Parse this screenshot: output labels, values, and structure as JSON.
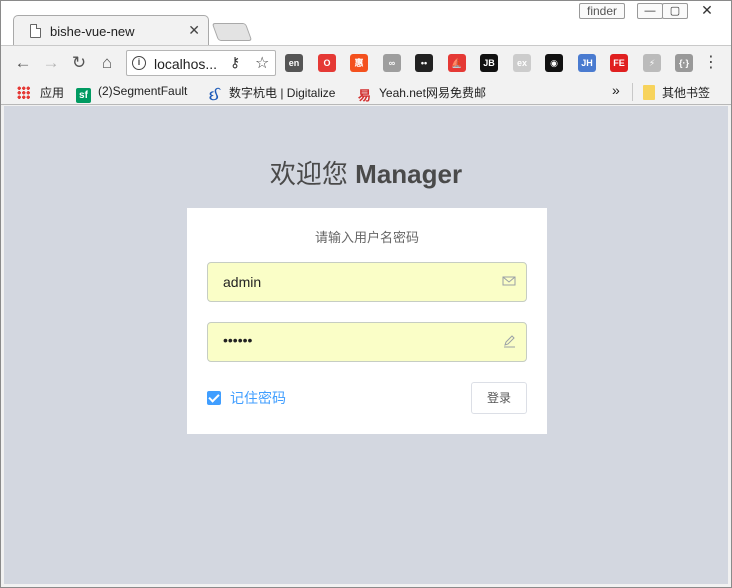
{
  "browser": {
    "tab_title": "bishe-vue-new",
    "finder_label": "finder",
    "url": "localhos...",
    "extensions": [
      {
        "name": "translate-extension",
        "text": "en",
        "color": "#555555"
      },
      {
        "name": "opera-extension",
        "text": "O",
        "color": "#e53935"
      },
      {
        "name": "coupon-extension",
        "text": "惠",
        "color": "#f4511e"
      },
      {
        "name": "glasses-extension",
        "text": "∞",
        "color": "#9e9e9e"
      },
      {
        "name": "dots-extension",
        "text": "••",
        "color": "#222222"
      },
      {
        "name": "ship-extension",
        "text": "⛵",
        "color": "#e53935"
      },
      {
        "name": "jetbrains-extension",
        "text": "JB",
        "color": "#111111"
      },
      {
        "name": "ex-extension",
        "text": "ex",
        "color": "#cccccc"
      },
      {
        "name": "eye-extension",
        "text": "◉",
        "color": "#111111"
      },
      {
        "name": "jh-extension",
        "text": "JH",
        "color": "#4a7bd0"
      },
      {
        "name": "fe-extension",
        "text": "FE",
        "color": "#e02020"
      },
      {
        "name": "bolt-extension",
        "text": "⚡",
        "color": "#bbbbbb"
      },
      {
        "name": "code-extension",
        "text": "{·}",
        "color": "#999999"
      }
    ]
  },
  "bookmarks": {
    "apps": "应用",
    "segmentfault": "(2)SegmentFault",
    "digitalize": "数字杭电 | Digitalize",
    "yeah": "Yeah.net网易免费邮",
    "overflow": "»",
    "other": "其他书签"
  },
  "page": {
    "heading_prefix": "欢迎您",
    "heading_name": "Manager",
    "subtitle": "请输入用户名密码",
    "username_value": "admin",
    "password_value": "••••••",
    "remember_label": "记住密码",
    "login_label": "登录"
  }
}
